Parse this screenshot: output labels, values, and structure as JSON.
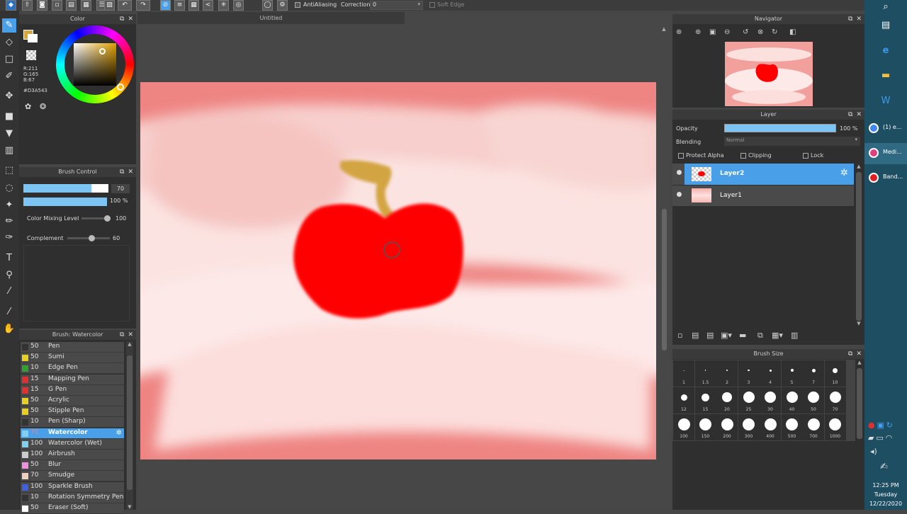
{
  "toolbar": {
    "antialiasing_label": "AntiAliasing",
    "correction_label": "Correction",
    "correction_value": "0",
    "soft_edge_label": "Soft Edge"
  },
  "canvas": {
    "tab_title": "Untitled"
  },
  "color_panel": {
    "title": "Color",
    "r": "R:211",
    "g": "G:165",
    "b": "B:67",
    "hex": "#D3A543",
    "primary_color": "#D3A543"
  },
  "brush_control": {
    "title": "Brush Control",
    "size_value": "70",
    "opacity_value": "100 %",
    "mixing_label": "Color Mixing Level",
    "mixing_value": "100",
    "complement_label": "Complement",
    "complement_value": "60"
  },
  "brush_list": {
    "title": "Brush: Watercolor",
    "items": [
      {
        "num": "50",
        "name": "Pen",
        "color": "#333333"
      },
      {
        "num": "50",
        "name": "Sumi",
        "color": "#e8d020"
      },
      {
        "num": "10",
        "name": "Edge Pen",
        "color": "#30a030"
      },
      {
        "num": "15",
        "name": "Mapping Pen",
        "color": "#e03030"
      },
      {
        "num": "15",
        "name": "G Pen",
        "color": "#e03030"
      },
      {
        "num": "50",
        "name": "Acrylic",
        "color": "#e8d020"
      },
      {
        "num": "50",
        "name": "Stipple Pen",
        "color": "#e8d020"
      },
      {
        "num": "10",
        "name": "Pen (Sharp)",
        "color": "#333333"
      },
      {
        "num": "70",
        "name": "Watercolor",
        "color": "#80d0f0"
      },
      {
        "num": "100",
        "name": "Watercolor (Wet)",
        "color": "#80d0f0"
      },
      {
        "num": "100",
        "name": "Airbrush",
        "color": "#cccccc"
      },
      {
        "num": "50",
        "name": "Blur",
        "color": "#f090e0"
      },
      {
        "num": "70",
        "name": "Smudge",
        "color": "#f0d0c0"
      },
      {
        "num": "100",
        "name": "Sparkle Brush",
        "color": "#4060e0"
      },
      {
        "num": "10",
        "name": "Rotation Symmetry Pen",
        "color": "#333333"
      },
      {
        "num": "50",
        "name": "Eraser (Soft)",
        "color": "#ffffff"
      }
    ]
  },
  "navigator": {
    "title": "Navigator"
  },
  "layer_panel": {
    "title": "Layer",
    "opacity_label": "Opacity",
    "opacity_value": "100 %",
    "blending_label": "Blending",
    "blending_value": "Normal",
    "protect_alpha": "Protect Alpha",
    "clipping": "Clipping",
    "lock": "Lock",
    "layers": [
      {
        "name": "Layer2"
      },
      {
        "name": "Layer1"
      }
    ]
  },
  "brush_size": {
    "title": "Brush Size",
    "sizes": [
      "1",
      "1.5",
      "2",
      "3",
      "4",
      "5",
      "7",
      "10",
      "12",
      "15",
      "20",
      "25",
      "30",
      "40",
      "50",
      "70",
      "100",
      "150",
      "200",
      "300",
      "400",
      "500",
      "700",
      "1000"
    ]
  },
  "taskbar": {
    "items": [
      {
        "label": "(1) e...",
        "color": "#4285f4"
      },
      {
        "label": "Medi...",
        "color": "#e04080"
      },
      {
        "label": "Band...",
        "color": "#e02020"
      }
    ],
    "time": "12:25 PM",
    "day": "Tuesday",
    "date": "12/22/2020"
  }
}
